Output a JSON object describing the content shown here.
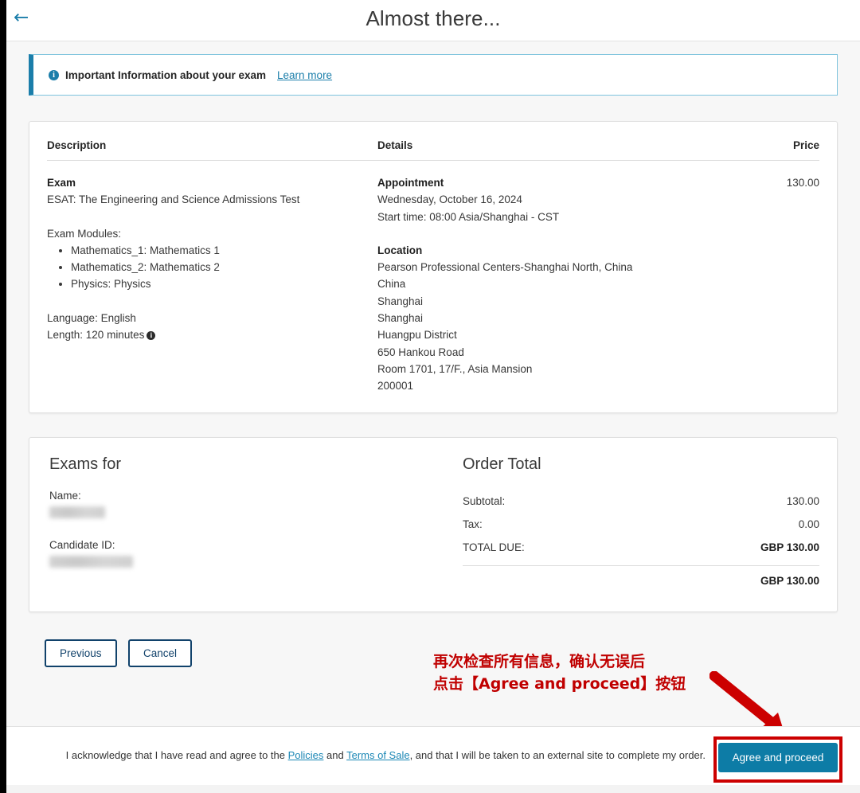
{
  "header": {
    "back_icon": "back-arrow-icon",
    "title": "Almost there..."
  },
  "banner": {
    "icon": "info-icon",
    "text": "Important Information about your exam",
    "link": "Learn more"
  },
  "order_table": {
    "columns": {
      "description": "Description",
      "details": "Details",
      "price": "Price"
    },
    "row": {
      "exam_heading": "Exam",
      "exam_name": "ESAT: The Engineering and Science Admissions Test",
      "modules_heading": "Exam Modules:",
      "modules": [
        "Mathematics_1: Mathematics 1",
        "Mathematics_2: Mathematics 2",
        "Physics: Physics"
      ],
      "language": "Language: English",
      "length": "Length: 120 minutes",
      "length_info_icon": "info-icon",
      "appointment_heading": "Appointment",
      "appointment_date": "Wednesday, October 16, 2024",
      "appointment_time": "Start time: 08:00 Asia/Shanghai - CST",
      "location_heading": "Location",
      "location_lines": [
        "Pearson Professional Centers-Shanghai North, China",
        "China",
        "Shanghai",
        "Shanghai",
        "Huangpu District",
        "650 Hankou Road",
        "Room 1701, 17/F., Asia Mansion",
        "200001"
      ],
      "price": "130.00"
    }
  },
  "exams_for": {
    "title": "Exams for",
    "name_label": "Name:",
    "name_value": "",
    "candidate_id_label": "Candidate ID:",
    "candidate_id_value": ""
  },
  "order_total": {
    "title": "Order Total",
    "rows": [
      {
        "label": "Subtotal:",
        "value": "130.00",
        "bold": false
      },
      {
        "label": "Tax:",
        "value": "0.00",
        "bold": false
      },
      {
        "label": "TOTAL DUE:",
        "value": "GBP 130.00",
        "bold": true
      }
    ],
    "grand_total": "GBP 130.00"
  },
  "actions": {
    "previous_label": "Previous",
    "cancel_label": "Cancel"
  },
  "annotation": {
    "line1": "再次检查所有信息，确认无误后",
    "line2": "点击【Agree and proceed】按钮",
    "arrow_icon": "red-arrow-icon",
    "color": "#c00000"
  },
  "footer": {
    "ack_part1": "I acknowledge that I have read and agree to the ",
    "policies_link": "Policies",
    "ack_part2": " and ",
    "terms_link": "Terms of Sale",
    "ack_part3": ", and that I will be taken to an external site to complete my order.",
    "agree_label": "Agree and proceed"
  },
  "colors": {
    "accent_teal": "#1b7eaa",
    "button_teal": "#0d7ca6",
    "outline_navy": "#11426b",
    "annotation_red": "#c00000",
    "highlight_red": "#cc0000",
    "page_bg": "#f7f7f7"
  }
}
